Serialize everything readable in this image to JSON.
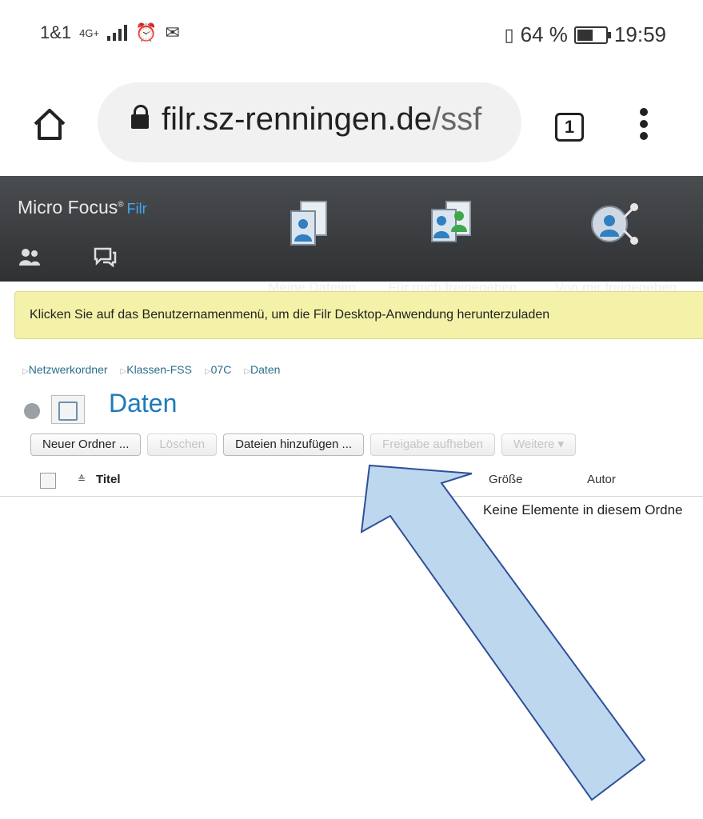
{
  "status_bar": {
    "carrier": "1&1",
    "network": "4G+",
    "battery_percent": "64 %",
    "battery_level": 0.64,
    "time": "19:59",
    "icons": [
      "signal-icon",
      "alarm-icon",
      "mail-icon",
      "vibrate-icon",
      "battery-icon"
    ]
  },
  "browser": {
    "url_host": "filr.sz-renningen.de",
    "url_path": "/ssf",
    "tab_count": "1"
  },
  "app": {
    "brand": "Micro Focus",
    "brand_product": "Filr",
    "nav": [
      {
        "label": "Meine Dateien",
        "icon": "my-files-icon"
      },
      {
        "label": "Für mich freigegeben",
        "icon": "shared-with-me-icon"
      },
      {
        "label": "Von mir freigegeben",
        "icon": "shared-by-me-icon"
      }
    ],
    "banner": "Klicken Sie auf das Benutzernamenmenü, um die Filr Desktop-Anwendung herunterzuladen",
    "breadcrumbs": [
      "Netzwerkordner",
      "Klassen-FSS",
      "07C",
      "Daten"
    ],
    "page_title": "Daten",
    "toolbar": {
      "new_folder": "Neuer Ordner ...",
      "delete": "Löschen",
      "add_files": "Dateien hinzufügen ...",
      "unshare": "Freigabe aufheben",
      "more": "Weitere ▾"
    },
    "table": {
      "col_title": "Titel",
      "col_size": "Größe",
      "col_author": "Autor",
      "empty_message": "Keine Elemente in diesem Ordne"
    }
  },
  "colors": {
    "header_bg": "#3a3c3e",
    "banner_bg": "#f3f2a8",
    "title": "#1d7ab8",
    "arrow_fill": "#bdd7ee",
    "arrow_stroke": "#2f4f9a"
  }
}
